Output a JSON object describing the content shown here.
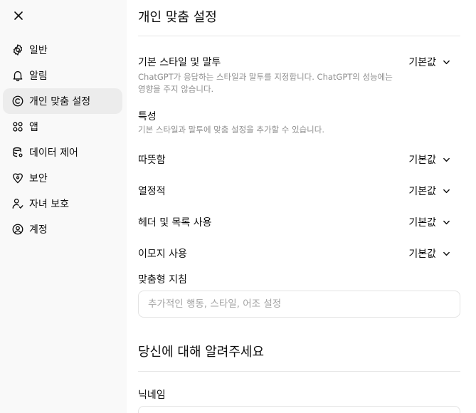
{
  "sidebar": {
    "items": [
      {
        "label": "일반",
        "icon": "gear-icon"
      },
      {
        "label": "알림",
        "icon": "bell-icon"
      },
      {
        "label": "개인 맞춤 설정",
        "icon": "personalization-icon",
        "active": true
      },
      {
        "label": "앱",
        "icon": "apps-grid-icon"
      },
      {
        "label": "데이터 제어",
        "icon": "database-icon"
      },
      {
        "label": "보안",
        "icon": "shield-icon"
      },
      {
        "label": "자녀 보호",
        "icon": "parental-controls-icon"
      },
      {
        "label": "계정",
        "icon": "account-icon"
      }
    ]
  },
  "main": {
    "title": "개인 맞춤 설정",
    "base_style": {
      "label": "기본 스타일 및 말투",
      "description": "ChatGPT가 응답하는 스타일과 말투를 지정합니다. ChatGPT의 성능에는 영향을 주지 않습니다.",
      "value": "기본값"
    },
    "traits": {
      "label": "특성",
      "description": "기본 스타일과 말투에 맞춤 설정을 추가할 수 있습니다."
    },
    "warmth": {
      "label": "따뜻함",
      "value": "기본값"
    },
    "enthusiasm": {
      "label": "열정적",
      "value": "기본값"
    },
    "headers_lists": {
      "label": "헤더 및 목록 사용",
      "value": "기본값"
    },
    "emoji": {
      "label": "이모지 사용",
      "value": "기본값"
    },
    "custom_instructions": {
      "label": "맞춤형 지침",
      "placeholder": "추가적인 행동, 스타일, 어조 설정"
    },
    "about_you": {
      "title": "당신에 대해 알려주세요",
      "nickname_label": "닉네임"
    }
  }
}
